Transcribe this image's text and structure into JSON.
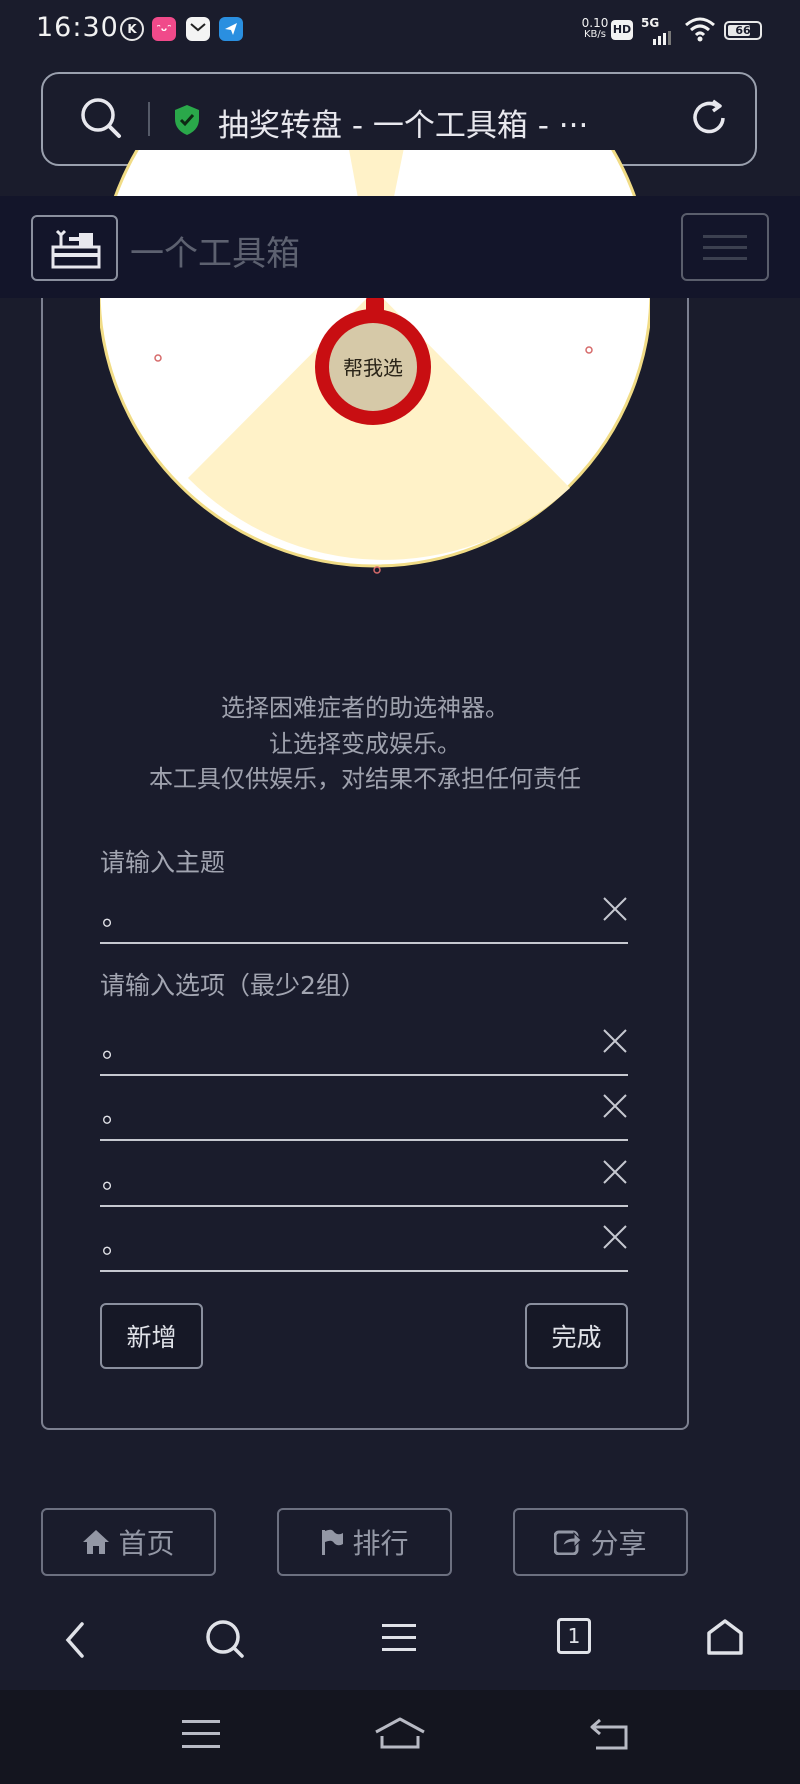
{
  "status_bar": {
    "time": "16:30",
    "net_speed_value": "0.10",
    "net_speed_unit": "KB/s",
    "hd_badge": "HD",
    "network": "5G",
    "battery": "66",
    "app_icons": [
      "k-icon",
      "pink-app-icon",
      "mail-icon",
      "paper-plane-icon"
    ]
  },
  "browser": {
    "tab_title": "抽奖转盘 - 一个工具箱 - ···",
    "secure_icon": "shield-check-icon",
    "toolbar_icons": [
      "back-icon",
      "search-icon",
      "menu-icon",
      "tabs-icon",
      "home-icon"
    ],
    "tab_count": "1"
  },
  "site": {
    "title": "一个工具箱"
  },
  "wheel": {
    "center_label": "帮我选",
    "colors": {
      "light": "#ffffff",
      "warm": "#fff2c8",
      "ring": "#c80e12",
      "hub": "#d6c9a8",
      "edge": "#e8d27a"
    }
  },
  "intro": {
    "line1": "选择困难症者的助选神器。",
    "line2": "让选择变成娱乐。",
    "line3": "本工具仅供娱乐，对结果不承担任何责任"
  },
  "form": {
    "topic_label": "请输入主题",
    "topic_value": "。",
    "options_label": "请输入选项（最少2组）",
    "option_values": [
      "。",
      "。",
      "。",
      "。"
    ],
    "add_button": "新增",
    "done_button": "完成"
  },
  "bottom_nav": {
    "home": "首页",
    "rank": "排行",
    "share": "分享"
  }
}
